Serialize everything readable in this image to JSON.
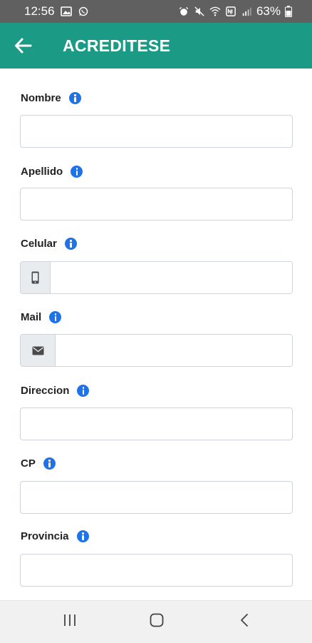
{
  "status_bar": {
    "time": "12:56",
    "battery": "63%"
  },
  "app_bar": {
    "title": "ACREDITESE",
    "background": "#1b9a86"
  },
  "form": {
    "fields": [
      {
        "label": "Nombre",
        "value": "",
        "addon_icon": null
      },
      {
        "label": "Apellido",
        "value": "",
        "addon_icon": null
      },
      {
        "label": "Celular",
        "value": "",
        "addon_icon": "mobile-phone-icon"
      },
      {
        "label": "Mail",
        "value": "",
        "addon_icon": "envelope-icon"
      },
      {
        "label": "Direccion",
        "value": "",
        "addon_icon": null
      },
      {
        "label": "CP",
        "value": "",
        "addon_icon": null
      },
      {
        "label": "Provincia",
        "value": "",
        "addon_icon": null
      }
    ],
    "info_icon_color": "#1e73e8"
  },
  "nav_bar": {
    "buttons": [
      "recent-apps-icon",
      "home-icon",
      "back-icon"
    ]
  }
}
